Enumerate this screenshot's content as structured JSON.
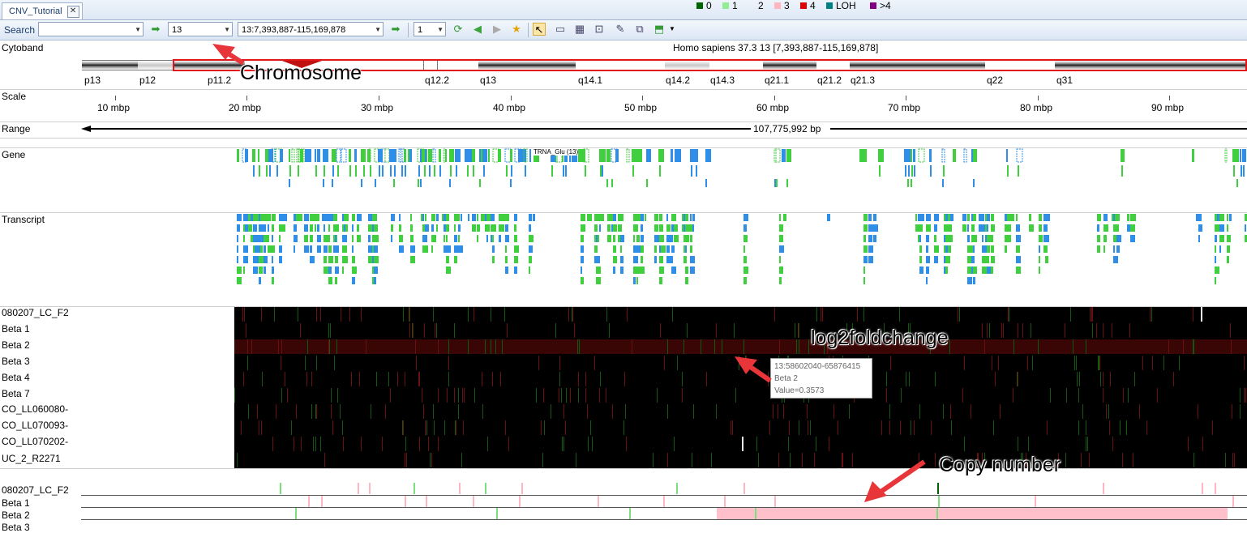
{
  "tab": {
    "label": "CNV_Tutorial"
  },
  "toolbar": {
    "search_label": "Search",
    "search_value": "",
    "chromosome_value": "13",
    "location_value": "13:7,393,887-115,169,878",
    "zoom_value": "1"
  },
  "header": {
    "genome_title": "Homo sapiens 37.3 13 [7,393,887-115,169,878]"
  },
  "tracks": {
    "cytoband": "Cytoband",
    "scale": "Scale",
    "range": "Range",
    "gene": "Gene",
    "transcript": "Transcript"
  },
  "cytobands": [
    "p13",
    "p12",
    "p11.2",
    "q12.2",
    "q13",
    "q14.1",
    "q14.2",
    "q14.3",
    "q21.1",
    "q21.2",
    "q21.3",
    "q22",
    "q31"
  ],
  "scale_ticks": [
    "10 mbp",
    "20 mbp",
    "30 mbp",
    "40 mbp",
    "50 mbp",
    "60 mbp",
    "70 mbp",
    "80 mbp",
    "90 mbp"
  ],
  "range_label": "107,775,992 bp",
  "gene_track": {
    "label_in_track": "TRNA_Glu (13)"
  },
  "samples": [
    "080207_LC_F2",
    "Beta 1",
    "Beta 2",
    "Beta 3",
    "Beta 4",
    "Beta 7",
    "CO_LL060080-",
    "CO_LL070093-",
    "CO_LL070202-",
    "UC_2_R2271"
  ],
  "tooltip": {
    "line1": "13:58602040-65876415",
    "line2": "Beta 2",
    "line3": "Value=0.3573"
  },
  "copy_number": {
    "legend": [
      {
        "label": "0",
        "color": "#006400"
      },
      {
        "label": "1",
        "color": "#90ee90"
      },
      {
        "label": "2",
        "color": "#ffffff"
      },
      {
        "label": "3",
        "color": "#ffb6c1"
      },
      {
        "label": "4",
        "color": "#e00000"
      },
      {
        "label": "LOH",
        "color": "#008080"
      },
      {
        "label": ">4",
        "color": "#800080"
      }
    ],
    "rows": [
      "080207_LC_F2",
      "Beta 1",
      "Beta 2",
      "Beta 3"
    ]
  },
  "annotations": {
    "chromosome": "Chromosome",
    "log2foldchange": "log2foldchange",
    "copy_number": "Copy number"
  },
  "colors": {
    "gene_green": "#3fcf3f",
    "gene_blue": "#2f8fe8",
    "highlight_red": "#e0161b",
    "heatmap_bg": "#000000"
  }
}
